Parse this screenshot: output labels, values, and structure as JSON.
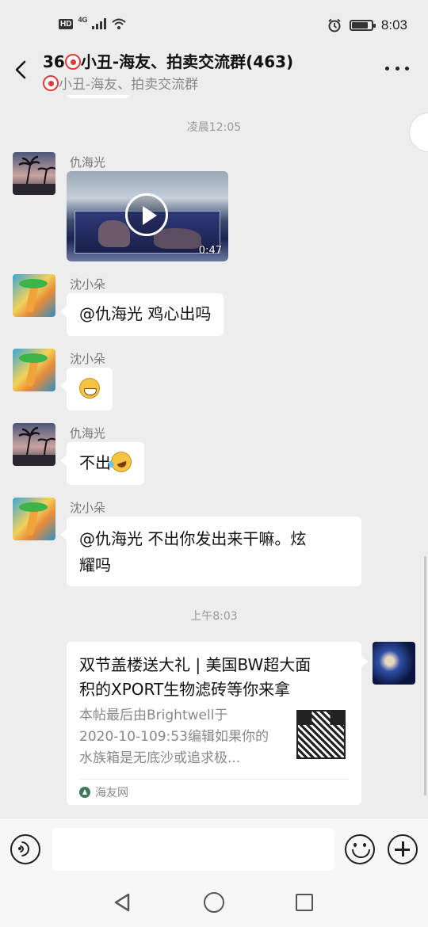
{
  "status_bar": {
    "hd": "HD",
    "network": "4G",
    "time": "8:03",
    "battery_level": 0.85
  },
  "header": {
    "title": "36🤡小丑-海友、拍卖交流群(463)",
    "title_prefix": "36",
    "title_rest": "小丑-海友、拍卖交流群(463)",
    "subtitle_rest": "小丑-海友、拍卖交流群"
  },
  "timestamps": {
    "first": "凌晨12:05",
    "second": "上午8:03"
  },
  "messages": [
    {
      "sender": "仇海光",
      "type": "video",
      "duration": "0:47"
    },
    {
      "sender": "沈小朵",
      "type": "text",
      "text": "@仇海光  鸡心出吗"
    },
    {
      "sender": "沈小朵",
      "type": "emoji",
      "emoji": "grinning-face"
    },
    {
      "sender": "仇海光",
      "type": "text",
      "text": "不出",
      "emoji": "rolling-laughing-face"
    },
    {
      "sender": "沈小朵",
      "type": "text",
      "text_line1": "@仇海光  不出你发出来干嘛。炫",
      "text_line2": "耀吗"
    }
  ],
  "link_card": {
    "title_line1": "双节盖楼送大礼 | 美国BW超大面",
    "title_line2": "积的XPORT生物滤砖等你来拿",
    "desc_line1": "本帖最后由Brightwell于",
    "desc_line2": "2020-10-109:53编辑如果你的",
    "desc_line3": "水族箱是无底沙或追求极...",
    "source": "海友网"
  },
  "input_bar": {
    "placeholder": ""
  },
  "colors": {
    "background": "#ededed",
    "bubble": "#ffffff",
    "muted_text": "#888888"
  }
}
